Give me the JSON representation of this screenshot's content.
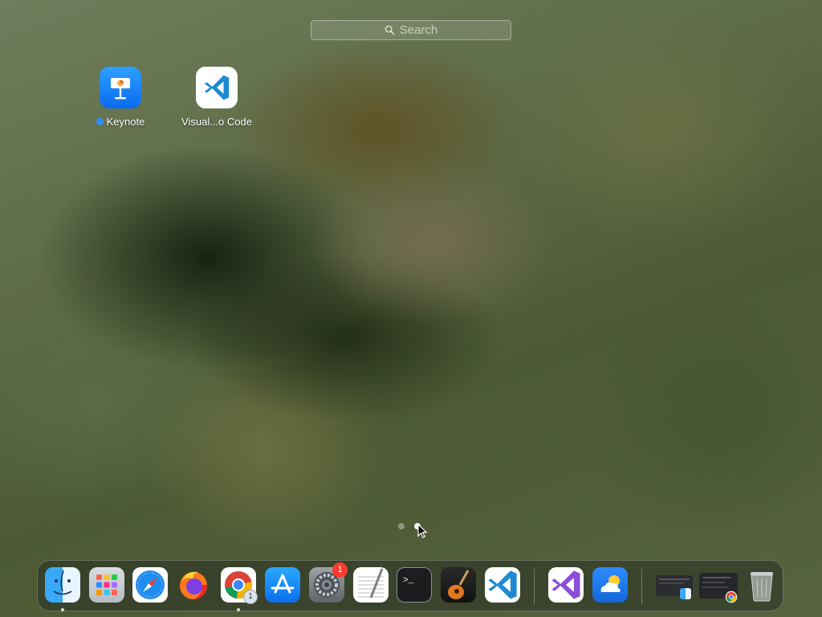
{
  "search": {
    "placeholder": "Search"
  },
  "apps": [
    {
      "name": "Keynote",
      "new_dot_color": "#2d8cff"
    },
    {
      "name": "Visual...o Code"
    }
  ],
  "pager": {
    "pages": 2,
    "current": 2
  },
  "dock": {
    "items": [
      {
        "name": "Finder",
        "icon": "finder-icon",
        "running": true
      },
      {
        "name": "Launchpad",
        "icon": "launchpad-icon"
      },
      {
        "name": "Safari",
        "icon": "safari-icon"
      },
      {
        "name": "Firefox",
        "icon": "firefox-icon"
      },
      {
        "name": "Google Chrome",
        "icon": "chrome-icon",
        "running": true,
        "count": "1"
      },
      {
        "name": "App Store",
        "icon": "app-store-icon"
      },
      {
        "name": "System Preferences",
        "icon": "system-preferences-icon",
        "badge": "1"
      },
      {
        "name": "TextEdit",
        "icon": "textedit-icon"
      },
      {
        "name": "Terminal",
        "icon": "terminal-icon"
      },
      {
        "name": "GarageBand",
        "icon": "garageband-icon"
      },
      {
        "name": "Visual Studio Code",
        "icon": "vscode-icon"
      },
      {
        "name": "Visual Studio",
        "icon": "visual-studio-icon"
      },
      {
        "name": "Weather",
        "icon": "weather-icon"
      },
      {
        "name": "Finder window",
        "icon": "minimized-window-icon"
      },
      {
        "name": "Chrome window",
        "icon": "minimized-window-icon"
      },
      {
        "name": "Trash",
        "icon": "trash-icon"
      }
    ]
  }
}
